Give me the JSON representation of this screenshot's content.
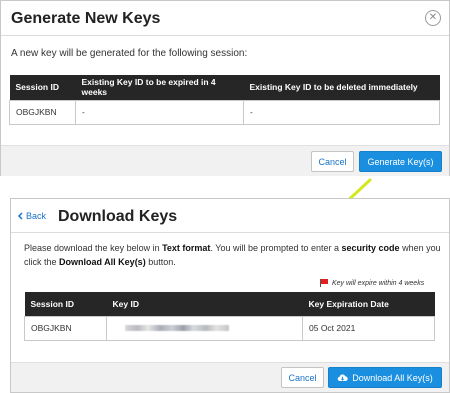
{
  "dialog1": {
    "title": "Generate New Keys",
    "close_symbol": "✕",
    "intro": "A new key will be generated for the following session:",
    "table": {
      "headers": [
        "Session ID",
        "Existing Key ID to be expired in 4 weeks",
        "Existing Key ID to be deleted immediately"
      ],
      "rows": [
        [
          "OBGJKBN",
          "-",
          "-"
        ]
      ]
    },
    "cancel_label": "Cancel",
    "generate_label": "Generate Key(s)"
  },
  "dialog2": {
    "back_label": "Back",
    "title": "Download Keys",
    "desc_part1": "Please download the key below in ",
    "desc_bold1": "Text format",
    "desc_part2": ". You will be prompted to enter a ",
    "desc_bold2": "security code",
    "desc_part3": " when you click the ",
    "desc_bold3": "Download All Key(s)",
    "desc_part4": " button.",
    "expire_note": "Key will expire within 4 weeks",
    "table": {
      "headers": [
        "Session ID",
        "Key ID",
        "Key Expiration Date"
      ],
      "rows": [
        [
          "OBGJKBN",
          "",
          "05 Oct 2021"
        ]
      ]
    },
    "cancel_label": "Cancel",
    "download_label": "Download All Key(s)"
  },
  "colors": {
    "accent": "#1a8fe0",
    "link": "#1a73c9",
    "table_header": "#262626",
    "arrow": "#d4e81e",
    "flag": "#e02020"
  },
  "icons": [
    "close-icon",
    "chevron-left-icon",
    "flag-icon",
    "cloud-download-icon"
  ]
}
